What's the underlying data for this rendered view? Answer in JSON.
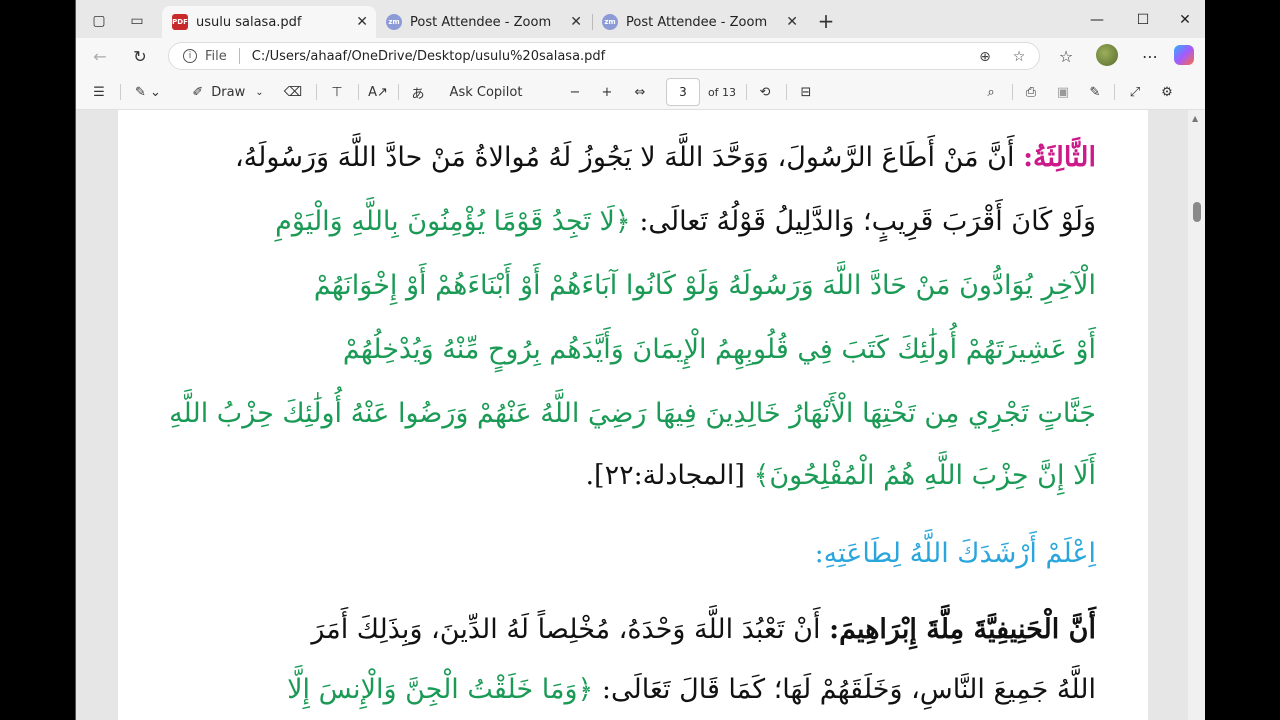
{
  "tabs": [
    {
      "title": "usulu salasa.pdf",
      "icon": "pdf-icon"
    },
    {
      "title": "Post Attendee - Zoom",
      "icon": "zoom-icon"
    },
    {
      "title": "Post Attendee - Zoom",
      "icon": "zoom-icon"
    }
  ],
  "address": {
    "scheme_label": "File",
    "url": "C:/Users/ahaaf/OneDrive/Desktop/usulu%20salasa.pdf"
  },
  "pdf_toolbar": {
    "draw_label": "Draw",
    "ask_copilot_label": "Ask Copilot",
    "page_value": "3",
    "page_total": "of 13"
  },
  "document": {
    "line1_marker": "الثَّالِثَةُ:",
    "line1_text": "أَنَّ مَنْ أَطَاعَ الرَّسُولَ، وَوَحَّدَ اللَّهَ لا يَجُوزُ لَهُ مُوالاةُ مَنْ حادَّ اللَّهَ وَرَسُولَهُ،",
    "line2_black": "وَلَوْ كَانَ أَقْرَبَ قَرِيبٍ؛ وَالدَّلِيلُ قَوْلُهُ تَعالَى:",
    "line2_green": "﴿لَا تَجِدُ قَوْمًا يُؤْمِنُونَ بِاللَّهِ وَالْيَوْمِ",
    "line3": "الْآخِرِ يُوَادُّونَ مَنْ حَادَّ اللَّهَ وَرَسُولَهُ وَلَوْ كَانُوا آبَاءَهُمْ أَوْ أَبْنَاءَهُمْ أَوْ إِخْوَانَهُمْ",
    "line4": "أَوْ عَشِيرَتَهُمْ أُولَٰئِكَ كَتَبَ فِي قُلُوبِهِمُ الْإِيمَانَ وَأَيَّدَهُم بِرُوحٍ مِّنْهُ وَيُدْخِلُهُمْ",
    "line5": "جَنَّاتٍ تَجْرِي مِن تَحْتِهَا الْأَنْهَارُ خَالِدِينَ فِيهَا رَضِيَ اللَّهُ عَنْهُمْ وَرَضُوا عَنْهُ أُولَٰئِكَ حِزْبُ اللَّهِ",
    "line6_green": "أَلَا إِنَّ حِزْبَ اللَّهِ هُمُ الْمُفْلِحُونَ﴾",
    "line6_black": "[المجادلة:٢٢].",
    "heading": "اِعْلَمْ أَرْشَدَكَ اللَّهُ لِطَاعَتِهِ:",
    "line7_bold": "أَنَّ الْحَنِيفِيَّةَ مِلَّةَ إِبْرَاهِيمَ:",
    "line7_text": "أَنْ تَعْبُدَ اللَّهَ وَحْدَهُ، مُخْلِصاً لَهُ الدِّينَ، وَبِذَلِكَ أَمَرَ",
    "line8_black": "اللَّهُ جَمِيعَ النَّاسِ، وَخَلَقَهُمْ لَهَا؛ كَمَا قَالَ تَعَالَى:",
    "line8_green": "﴿وَمَا خَلَقْتُ الْجِنَّ وَالْإِنسَ إِلَّا"
  },
  "colors": {
    "quran_green": "#1a9a55",
    "heading_blue": "#2aa6dd",
    "marker_magenta": "#cc1a8a"
  }
}
